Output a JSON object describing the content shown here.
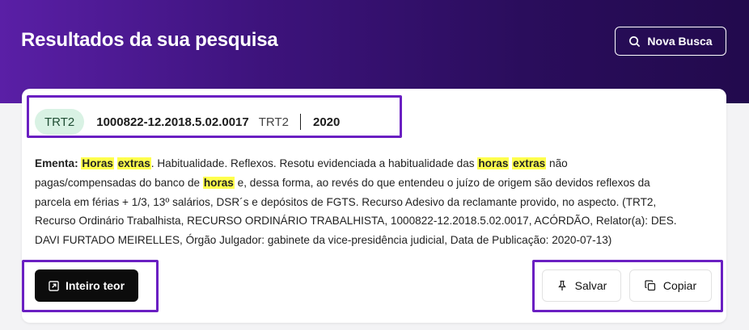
{
  "header": {
    "title": "Resultados da sua pesquisa",
    "new_search_label": "Nova Busca"
  },
  "result": {
    "court_badge": "TRT2",
    "case_number": "1000822-12.2018.5.02.0017",
    "court": "TRT2",
    "separator": "|",
    "year": "2020",
    "ementa_label": "Ementa:",
    "highlight_color": "#ffff4d",
    "ementa_lines": [
      [
        {
          "t": "Horas",
          "hl": true
        },
        {
          "t": " "
        },
        {
          "t": "extras",
          "hl": true
        },
        {
          "t": ". Habitualidade. Reflexos. Resotu evidenciada a habitualidade das "
        },
        {
          "t": "horas",
          "hl": true
        },
        {
          "t": " "
        },
        {
          "t": "extras",
          "hl": true
        },
        {
          "t": " não"
        }
      ],
      [
        {
          "t": "pagas/compensadas do banco de "
        },
        {
          "t": "horas",
          "hl": true
        },
        {
          "t": " e, dessa forma, ao revés do que entendeu o juízo de origem são devidos reflexos da"
        }
      ],
      [
        {
          "t": "parcela em férias + 1/3, 13º salários, DSR´s e depósitos de FGTS. Recurso Adesivo da reclamante provido, no aspecto. (TRT2,"
        }
      ],
      [
        {
          "t": "Recurso Ordinário Trabalhista, RECURSO ORDINÁRIO TRABALHISTA, 1000822-12.2018.5.02.0017, ACÓRDÃO, Relator(a): DES."
        }
      ],
      [
        {
          "t": "DAVI FURTADO MEIRELLES, Órgão Julgador: gabinete da vice-presidência judicial, Data de Publicação: 2020-07-13)"
        }
      ]
    ]
  },
  "actions": {
    "full_text_label": "Inteiro teor",
    "save_label": "Salvar",
    "copy_label": "Copiar"
  },
  "icons": {
    "search": "search-icon",
    "external_link": "external-link-icon",
    "pin": "pin-icon",
    "copy": "copy-icon"
  },
  "colors": {
    "hero_purple": "#3d137c",
    "badge_green": "#d9f2e4",
    "annotation_box": "#6a1fc2"
  }
}
